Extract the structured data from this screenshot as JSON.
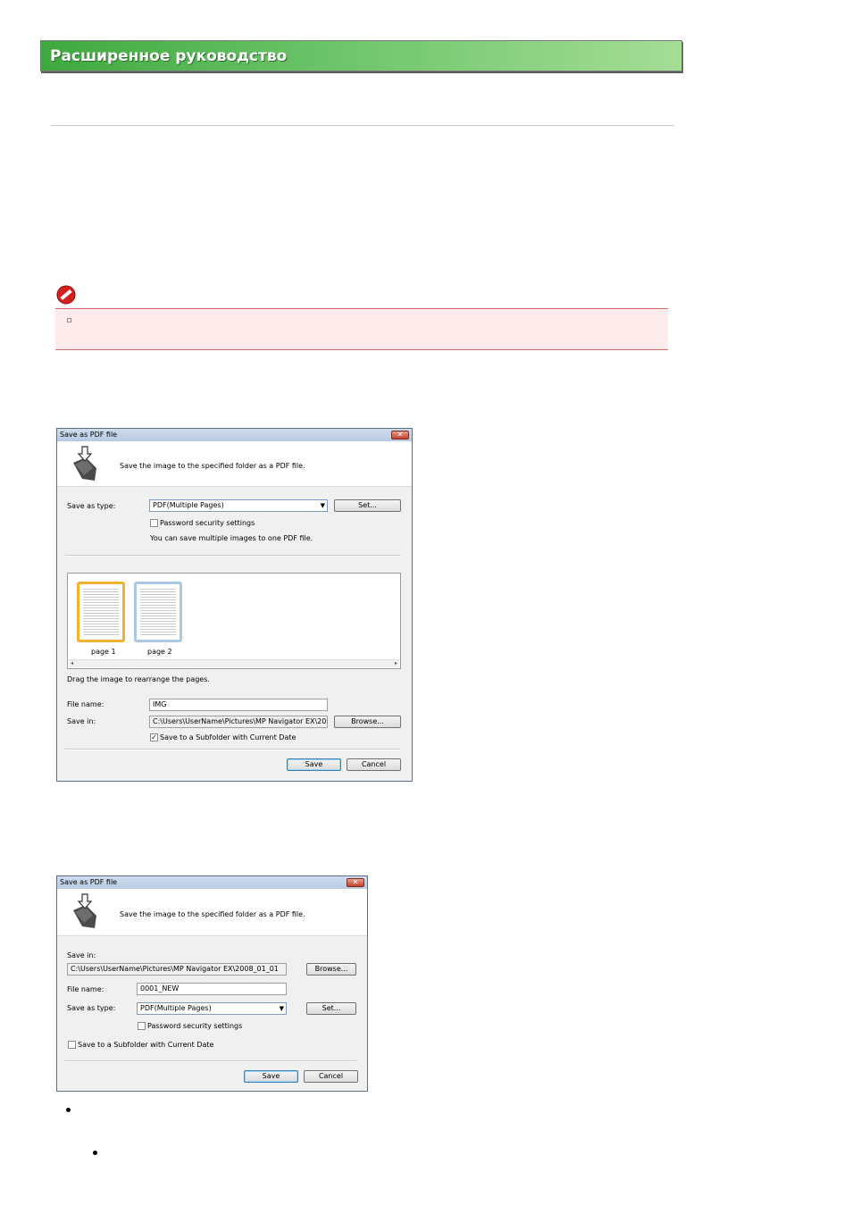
{
  "header": {
    "title": "Расширенное руководство"
  },
  "dialog1": {
    "title": "Save as PDF file",
    "close_glyph": "✕",
    "description": "Save the image to the specified folder as a PDF file.",
    "save_as_type_label": "Save as  type:",
    "save_as_type_value": "PDF(Multiple Pages)",
    "set_button": "Set...",
    "password_label": "Password security settings",
    "info_text": "You can save multiple images to one PDF file.",
    "pages": [
      "page 1",
      "page 2"
    ],
    "drag_hint": "Drag the image to rearrange the pages.",
    "file_name_label": "File name:",
    "file_name_value": "IMG",
    "save_in_label": "Save in:",
    "save_in_value": "C:\\Users\\UserName\\Pictures\\MP Navigator EX\\2008_0",
    "browse_button": "Browse...",
    "subfolder_label": "Save to a Subfolder with Current Date",
    "subfolder_checked": true,
    "save_button": "Save",
    "cancel_button": "Cancel"
  },
  "dialog2": {
    "title": "Save as PDF file",
    "close_glyph": "✕",
    "description": "Save the image to the specified folder as a PDF file.",
    "save_in_label": "Save in:",
    "save_in_value": "C:\\Users\\UserName\\Pictures\\MP Navigator EX\\2008_01_01",
    "browse_button": "Browse...",
    "file_name_label": "File name:",
    "file_name_value": "0001_NEW",
    "save_as_type_label": "Save as  type:",
    "save_as_type_value": "PDF(Multiple Pages)",
    "set_button": "Set...",
    "password_label": "Password security settings",
    "subfolder_label": "Save to a Subfolder with Current Date",
    "subfolder_checked": false,
    "save_button": "Save",
    "cancel_button": "Cancel"
  },
  "icons": {
    "important": "no-entry-icon",
    "save_pdf": "save-folder-icon"
  },
  "colors": {
    "header_green": "#4caf4a",
    "note_border": "#d36a6a",
    "note_bg": "#fdeceb"
  }
}
